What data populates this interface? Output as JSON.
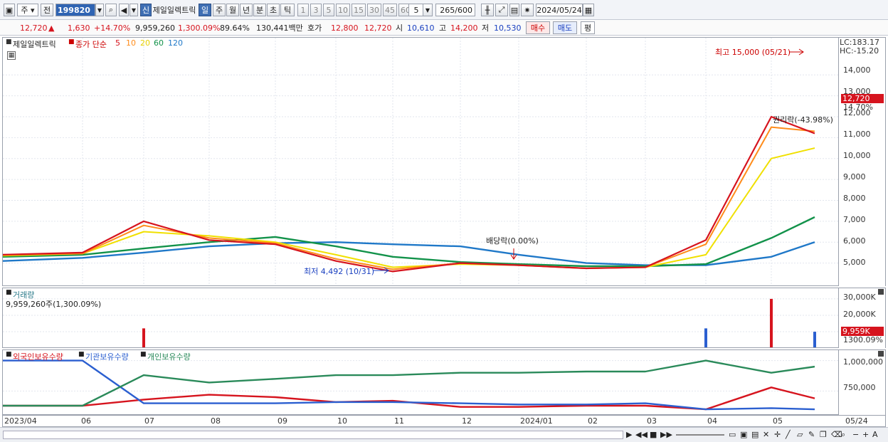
{
  "toolbar": {
    "market": "주",
    "prev": "전",
    "code": "199820",
    "new_badge": "신",
    "name": "제일일렉트릭",
    "periods": [
      "일",
      "주",
      "월",
      "년",
      "분",
      "초",
      "틱"
    ],
    "intervals": [
      "1",
      "3",
      "5",
      "10",
      "15",
      "30",
      "45",
      "60"
    ],
    "count_value": "5",
    "range_text": "265/600",
    "date": "2024/05/24"
  },
  "quote": {
    "price": "12,720",
    "arrow": "▲",
    "change": "1,630",
    "change_pct": "+14.70%",
    "volume": "9,959,260",
    "vol_pct": "1,300.09%",
    "turnover": "89.64%",
    "amount": "130,441백만",
    "hoga_label": "호가",
    "hoga_ask": "12,800",
    "hoga_bid": "12,720",
    "open_label": "시",
    "open": "10,610",
    "high_label": "고",
    "high": "14,200",
    "low_label": "저",
    "low": "10,530",
    "buy": "매수",
    "sell": "매도",
    "eval": "평"
  },
  "main_panel": {
    "stock_name": "제일일렉트릭",
    "ma_label": "종가 단순",
    "ma_periods": [
      {
        "label": "5",
        "color": "#d6141e"
      },
      {
        "label": "10",
        "color": "#ff8c1a"
      },
      {
        "label": "20",
        "color": "#f0e000"
      },
      {
        "label": "60",
        "color": "#12924a"
      },
      {
        "label": "120",
        "color": "#1f78c8"
      }
    ],
    "lc": "LC:183.17",
    "hc": "HC:-15.20",
    "high_annot": "최고 15,000 (05/21)",
    "low_annot": "최저 4,492 (10/31)",
    "div_annot": "배당락(0.00%)",
    "rights_annot": "권리락(-43.98%)",
    "current_price": "12,720",
    "current_pct": "14.70%",
    "y_ticks": [
      "14,000",
      "13,000",
      "12,000",
      "11,000",
      "10,000",
      "9,000",
      "8,000",
      "7,000",
      "6,000",
      "5,000"
    ]
  },
  "volume_panel": {
    "title": "거래량",
    "info": "9,959,260주(1,300.09%)",
    "y_ticks": [
      "30,000K",
      "20,000K",
      "10,000K"
    ],
    "current": "9,959K",
    "current_pct": "1300.09%"
  },
  "holding_panel": {
    "titles": [
      "외국인보유수량",
      "기관보유수량",
      "개인보유수량"
    ],
    "colors": [
      "#d6141e",
      "#2b5fd0",
      "#2a8a5a"
    ],
    "y_ticks": [
      "1,000,000",
      "750,000"
    ]
  },
  "x_axis": [
    "2023/04",
    "06",
    "07",
    "08",
    "09",
    "10",
    "11",
    "12",
    "2024/01",
    "02",
    "03",
    "04",
    "05",
    "05/24"
  ],
  "chart_data": [
    {
      "type": "line",
      "title": "제일일렉트릭",
      "x": [
        "2023/04",
        "06",
        "07",
        "08",
        "09",
        "10",
        "11",
        "12",
        "2024/01",
        "02",
        "03",
        "04",
        "05",
        "05/24"
      ],
      "series": [
        {
          "name": "5",
          "values": [
            5400,
            5500,
            7000,
            6100,
            5900,
            5100,
            4600,
            5000,
            4900,
            4750,
            4800,
            6100,
            12000,
            11200
          ]
        },
        {
          "name": "10",
          "values": [
            5400,
            5450,
            6800,
            6200,
            5950,
            5200,
            4700,
            5000,
            4900,
            4750,
            4800,
            5900,
            11500,
            11300
          ]
        },
        {
          "name": "20",
          "values": [
            5350,
            5450,
            6500,
            6300,
            6000,
            5400,
            4800,
            4950,
            4900,
            4750,
            4800,
            5400,
            10000,
            10500
          ]
        },
        {
          "name": "60",
          "values": [
            5300,
            5400,
            5700,
            6000,
            6250,
            5800,
            5300,
            5050,
            4950,
            4850,
            4850,
            4950,
            6200,
            7200
          ]
        },
        {
          "name": "120",
          "values": [
            5100,
            5250,
            5500,
            5800,
            5950,
            6000,
            5900,
            5800,
            5400,
            5000,
            4900,
            4900,
            5300,
            6000
          ]
        }
      ],
      "ylim": [
        4000,
        15300
      ],
      "annotations": [
        "최고 15,000 (05/21)",
        "최저 4,492 (10/31)",
        "배당락(0.00%)",
        "권리락(-43.98%)"
      ]
    },
    {
      "type": "bar",
      "title": "거래량",
      "categories": [
        "2023/04",
        "06",
        "07",
        "08",
        "09",
        "10",
        "11",
        "12",
        "2024/01",
        "02",
        "03",
        "04",
        "05",
        "05/24"
      ],
      "values": [
        50,
        80,
        12000,
        200,
        150,
        100,
        120,
        80,
        60,
        50,
        200,
        12000,
        30000,
        9959
      ],
      "ylim": [
        0,
        33000
      ]
    },
    {
      "type": "line",
      "title": "보유수량",
      "x": [
        "2023/04",
        "06",
        "07",
        "08",
        "09",
        "10",
        "11",
        "12",
        "2024/01",
        "02",
        "03",
        "04",
        "05",
        "05/24"
      ],
      "series": [
        {
          "name": "외국인보유수량",
          "values": [
            630000,
            630000,
            680000,
            720000,
            700000,
            660000,
            670000,
            620000,
            620000,
            630000,
            630000,
            600000,
            780000,
            690000
          ]
        },
        {
          "name": "기관보유수량",
          "values": [
            1000000,
            1000000,
            650000,
            650000,
            650000,
            660000,
            660000,
            650000,
            640000,
            640000,
            650000,
            600000,
            610000,
            600000
          ]
        },
        {
          "name": "개인보유수량",
          "values": [
            630000,
            630000,
            880000,
            820000,
            850000,
            880000,
            880000,
            900000,
            900000,
            910000,
            910000,
            1000000,
            900000,
            950000
          ]
        }
      ],
      "ylim": [
        560000,
        1050000
      ]
    }
  ]
}
